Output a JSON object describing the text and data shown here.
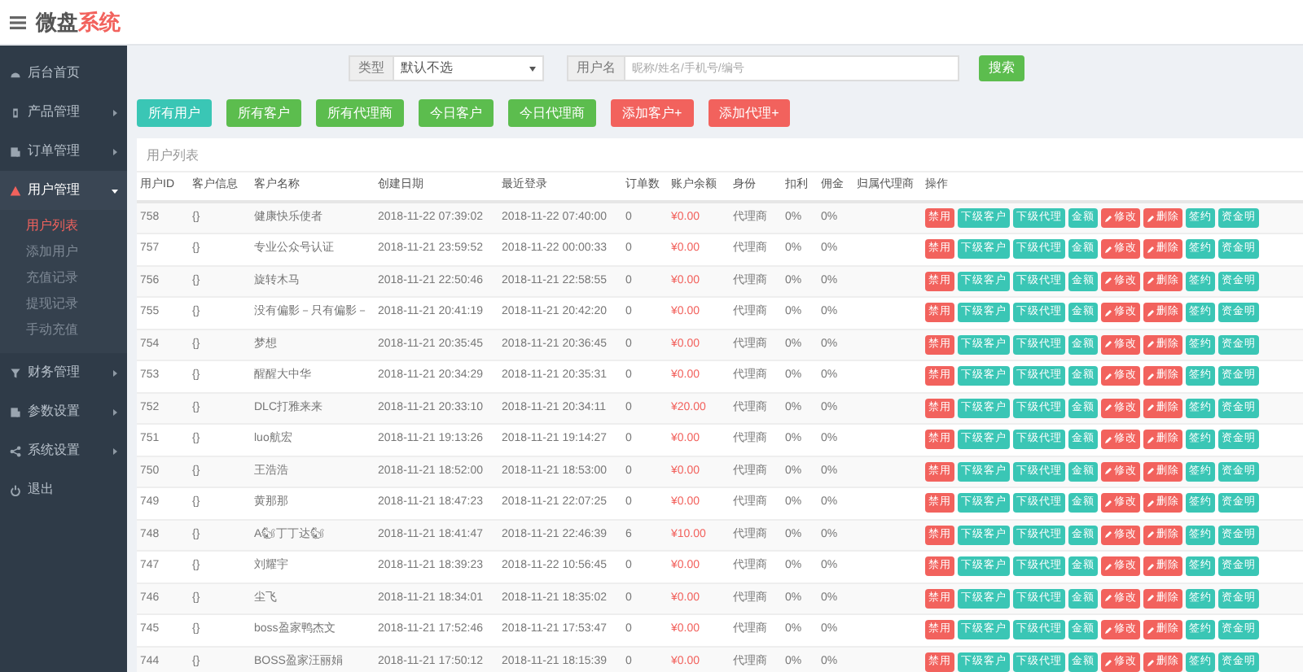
{
  "header": {
    "brand_main": "微盘",
    "brand_accent": "系统"
  },
  "sidebar": {
    "items": [
      {
        "label": "后台首页",
        "selected": false,
        "kind": "link"
      },
      {
        "label": "产品管理",
        "selected": false,
        "expanded": false,
        "kind": "group"
      },
      {
        "label": "订单管理",
        "selected": false,
        "expanded": false,
        "kind": "group"
      },
      {
        "label": "用户管理",
        "selected": true,
        "expanded": true,
        "kind": "group",
        "children": [
          {
            "label": "用户列表",
            "selected": true
          },
          {
            "label": "添加用户",
            "selected": false
          },
          {
            "label": "充值记录",
            "selected": false
          },
          {
            "label": "提现记录",
            "selected": false
          },
          {
            "label": "手动充值",
            "selected": false
          }
        ]
      },
      {
        "label": "财务管理",
        "selected": false,
        "expanded": false,
        "kind": "group"
      },
      {
        "label": "参数设置",
        "selected": false,
        "expanded": false,
        "kind": "group"
      },
      {
        "label": "系统设置",
        "selected": false,
        "expanded": false,
        "kind": "group"
      },
      {
        "label": "退出",
        "selected": false,
        "kind": "link"
      }
    ]
  },
  "filters": {
    "type_label": "类型",
    "type_value": "默认不选",
    "user_label": "用户名",
    "user_placeholder": "昵称/姓名/手机号/编号",
    "search_button": "搜索"
  },
  "quick_buttons": [
    {
      "label": "所有用户",
      "color": "#3ac6b5"
    },
    {
      "label": "所有客户",
      "color": "#5cbd4e"
    },
    {
      "label": "所有代理商",
      "color": "#5cbd4e"
    },
    {
      "label": "今日客户",
      "color": "#5cbd4e"
    },
    {
      "label": "今日代理商",
      "color": "#5cbd4e"
    },
    {
      "label": "添加客户+",
      "color": "#f2625d"
    },
    {
      "label": "添加代理+",
      "color": "#f2625d"
    }
  ],
  "panel": {
    "title": "用户列表"
  },
  "table": {
    "columns": [
      "用户ID",
      "客户信息",
      "客户名称",
      "创建日期",
      "最近登录",
      "订单数",
      "账户余额",
      "身份",
      "扣利",
      "佣金",
      "归属代理商",
      "操作"
    ],
    "rows": [
      {
        "id": "758",
        "info": "{}",
        "name": "健康快乐使者",
        "created": "2018-11-22 07:39:02",
        "last_login": "2018-11-22 07:40:00",
        "orders": "0",
        "balance": "¥0.00",
        "role": "代理商",
        "rebate": "0%",
        "commission": "0%",
        "actions": [
          {
            "kind": "disable",
            "label": "禁用",
            "color": "#f2625d"
          },
          {
            "kind": "sub-customers",
            "label": "下级客户",
            "color": "#3ac6b5"
          },
          {
            "kind": "sub-agents",
            "label": "下级代理",
            "color": "#3ac6b5"
          },
          {
            "kind": "amount",
            "label": "金额",
            "color": "#3ac6b5"
          },
          {
            "kind": "edit",
            "label": "修改",
            "color": "#f2625d"
          },
          {
            "kind": "delete",
            "label": "删除",
            "color": "#f2625d"
          },
          {
            "kind": "sign",
            "label": "签约",
            "color": "#3ac6b5"
          },
          {
            "kind": "funds",
            "label": "资金明",
            "color": "#3ac6b5"
          }
        ]
      },
      {
        "id": "757",
        "info": "{}",
        "name": "专业公众号认证",
        "created": "2018-11-21 23:59:52",
        "last_login": "2018-11-22 00:00:33",
        "orders": "0",
        "balance": "¥0.00",
        "role": "代理商",
        "rebate": "0%",
        "commission": "0%",
        "actions": [
          {
            "kind": "disable",
            "label": "禁用",
            "color": "#f2625d"
          },
          {
            "kind": "sub-customers",
            "label": "下级客户",
            "color": "#3ac6b5"
          },
          {
            "kind": "sub-agents",
            "label": "下级代理",
            "color": "#3ac6b5"
          },
          {
            "kind": "amount",
            "label": "金额",
            "color": "#3ac6b5"
          },
          {
            "kind": "edit",
            "label": "修改",
            "color": "#f2625d"
          },
          {
            "kind": "delete",
            "label": "删除",
            "color": "#f2625d"
          },
          {
            "kind": "sign",
            "label": "签约",
            "color": "#3ac6b5"
          },
          {
            "kind": "funds",
            "label": "资金明",
            "color": "#3ac6b5"
          }
        ]
      },
      {
        "id": "756",
        "info": "{}",
        "name": "旋转木马",
        "created": "2018-11-21 22:50:46",
        "last_login": "2018-11-21 22:58:55",
        "orders": "0",
        "balance": "¥0.00",
        "role": "代理商",
        "rebate": "0%",
        "commission": "0%",
        "actions": [
          {
            "kind": "disable",
            "label": "禁用",
            "color": "#f2625d"
          },
          {
            "kind": "sub-customers",
            "label": "下级客户",
            "color": "#3ac6b5"
          },
          {
            "kind": "sub-agents",
            "label": "下级代理",
            "color": "#3ac6b5"
          },
          {
            "kind": "amount",
            "label": "金额",
            "color": "#3ac6b5"
          },
          {
            "kind": "edit",
            "label": "修改",
            "color": "#f2625d"
          },
          {
            "kind": "delete",
            "label": "删除",
            "color": "#f2625d"
          },
          {
            "kind": "sign",
            "label": "签约",
            "color": "#3ac6b5"
          },
          {
            "kind": "funds",
            "label": "资金明",
            "color": "#3ac6b5"
          }
        ]
      },
      {
        "id": "755",
        "info": "{}",
        "name": "没有偏影－只有偏影－",
        "created": "2018-11-21 20:41:19",
        "last_login": "2018-11-21 20:42:20",
        "orders": "0",
        "balance": "¥0.00",
        "role": "代理商",
        "rebate": "0%",
        "commission": "0%",
        "actions": [
          {
            "kind": "disable",
            "label": "禁用",
            "color": "#f2625d"
          },
          {
            "kind": "sub-customers",
            "label": "下级客户",
            "color": "#3ac6b5"
          },
          {
            "kind": "sub-agents",
            "label": "下级代理",
            "color": "#3ac6b5"
          },
          {
            "kind": "amount",
            "label": "金额",
            "color": "#3ac6b5"
          },
          {
            "kind": "edit",
            "label": "修改",
            "color": "#f2625d"
          },
          {
            "kind": "delete",
            "label": "删除",
            "color": "#f2625d"
          },
          {
            "kind": "sign",
            "label": "签约",
            "color": "#3ac6b5"
          },
          {
            "kind": "funds",
            "label": "资金明",
            "color": "#3ac6b5"
          }
        ]
      },
      {
        "id": "754",
        "info": "{}",
        "name": "梦想",
        "created": "2018-11-21 20:35:45",
        "last_login": "2018-11-21 20:36:45",
        "orders": "0",
        "balance": "¥0.00",
        "role": "代理商",
        "rebate": "0%",
        "commission": "0%",
        "actions": [
          {
            "kind": "disable",
            "label": "禁用",
            "color": "#f2625d"
          },
          {
            "kind": "sub-customers",
            "label": "下级客户",
            "color": "#3ac6b5"
          },
          {
            "kind": "sub-agents",
            "label": "下级代理",
            "color": "#3ac6b5"
          },
          {
            "kind": "amount",
            "label": "金额",
            "color": "#3ac6b5"
          },
          {
            "kind": "edit",
            "label": "修改",
            "color": "#f2625d"
          },
          {
            "kind": "delete",
            "label": "删除",
            "color": "#f2625d"
          },
          {
            "kind": "sign",
            "label": "签约",
            "color": "#3ac6b5"
          },
          {
            "kind": "funds",
            "label": "资金明",
            "color": "#3ac6b5"
          }
        ]
      },
      {
        "id": "753",
        "info": "{}",
        "name": "醒醒大中华",
        "created": "2018-11-21 20:34:29",
        "last_login": "2018-11-21 20:35:31",
        "orders": "0",
        "balance": "¥0.00",
        "role": "代理商",
        "rebate": "0%",
        "commission": "0%",
        "actions": [
          {
            "kind": "disable",
            "label": "禁用",
            "color": "#f2625d"
          },
          {
            "kind": "sub-customers",
            "label": "下级客户",
            "color": "#3ac6b5"
          },
          {
            "kind": "sub-agents",
            "label": "下级代理",
            "color": "#3ac6b5"
          },
          {
            "kind": "amount",
            "label": "金额",
            "color": "#3ac6b5"
          },
          {
            "kind": "edit",
            "label": "修改",
            "color": "#f2625d"
          },
          {
            "kind": "delete",
            "label": "删除",
            "color": "#f2625d"
          },
          {
            "kind": "sign",
            "label": "签约",
            "color": "#3ac6b5"
          },
          {
            "kind": "funds",
            "label": "资金明",
            "color": "#3ac6b5"
          }
        ]
      },
      {
        "id": "752",
        "info": "{}",
        "name": "DLC打雅来来",
        "created": "2018-11-21 20:33:10",
        "last_login": "2018-11-21 20:34:11",
        "orders": "0",
        "balance": "¥20.00",
        "role": "代理商",
        "rebate": "0%",
        "commission": "0%",
        "actions": [
          {
            "kind": "disable",
            "label": "禁用",
            "color": "#f2625d"
          },
          {
            "kind": "sub-customers",
            "label": "下级客户",
            "color": "#3ac6b5"
          },
          {
            "kind": "sub-agents",
            "label": "下级代理",
            "color": "#3ac6b5"
          },
          {
            "kind": "amount",
            "label": "金额",
            "color": "#3ac6b5"
          },
          {
            "kind": "edit",
            "label": "修改",
            "color": "#f2625d"
          },
          {
            "kind": "delete",
            "label": "删除",
            "color": "#f2625d"
          },
          {
            "kind": "sign",
            "label": "签约",
            "color": "#3ac6b5"
          },
          {
            "kind": "funds",
            "label": "资金明",
            "color": "#3ac6b5"
          }
        ]
      },
      {
        "id": "751",
        "info": "{}",
        "name": "luo航宏",
        "created": "2018-11-21 19:13:26",
        "last_login": "2018-11-21 19:14:27",
        "orders": "0",
        "balance": "¥0.00",
        "role": "代理商",
        "rebate": "0%",
        "commission": "0%",
        "actions": [
          {
            "kind": "disable",
            "label": "禁用",
            "color": "#f2625d"
          },
          {
            "kind": "sub-customers",
            "label": "下级客户",
            "color": "#3ac6b5"
          },
          {
            "kind": "sub-agents",
            "label": "下级代理",
            "color": "#3ac6b5"
          },
          {
            "kind": "amount",
            "label": "金额",
            "color": "#3ac6b5"
          },
          {
            "kind": "edit",
            "label": "修改",
            "color": "#f2625d"
          },
          {
            "kind": "delete",
            "label": "删除",
            "color": "#f2625d"
          },
          {
            "kind": "sign",
            "label": "签约",
            "color": "#3ac6b5"
          },
          {
            "kind": "funds",
            "label": "资金明",
            "color": "#3ac6b5"
          }
        ]
      },
      {
        "id": "750",
        "info": "{}",
        "name": "王浩浩",
        "created": "2018-11-21 18:52:00",
        "last_login": "2018-11-21 18:53:00",
        "orders": "0",
        "balance": "¥0.00",
        "role": "代理商",
        "rebate": "0%",
        "commission": "0%",
        "actions": [
          {
            "kind": "disable",
            "label": "禁用",
            "color": "#f2625d"
          },
          {
            "kind": "sub-customers",
            "label": "下级客户",
            "color": "#3ac6b5"
          },
          {
            "kind": "sub-agents",
            "label": "下级代理",
            "color": "#3ac6b5"
          },
          {
            "kind": "amount",
            "label": "金额",
            "color": "#3ac6b5"
          },
          {
            "kind": "edit",
            "label": "修改",
            "color": "#f2625d"
          },
          {
            "kind": "delete",
            "label": "删除",
            "color": "#f2625d"
          },
          {
            "kind": "sign",
            "label": "签约",
            "color": "#3ac6b5"
          },
          {
            "kind": "funds",
            "label": "资金明",
            "color": "#3ac6b5"
          }
        ]
      },
      {
        "id": "749",
        "info": "{}",
        "name": "黄那那",
        "created": "2018-11-21 18:47:23",
        "last_login": "2018-11-21 22:07:25",
        "orders": "0",
        "balance": "¥0.00",
        "role": "代理商",
        "rebate": "0%",
        "commission": "0%",
        "actions": [
          {
            "kind": "disable",
            "label": "禁用",
            "color": "#f2625d"
          },
          {
            "kind": "sub-customers",
            "label": "下级客户",
            "color": "#3ac6b5"
          },
          {
            "kind": "sub-agents",
            "label": "下级代理",
            "color": "#3ac6b5"
          },
          {
            "kind": "amount",
            "label": "金额",
            "color": "#3ac6b5"
          },
          {
            "kind": "edit",
            "label": "修改",
            "color": "#f2625d"
          },
          {
            "kind": "delete",
            "label": "删除",
            "color": "#f2625d"
          },
          {
            "kind": "sign",
            "label": "签约",
            "color": "#3ac6b5"
          },
          {
            "kind": "funds",
            "label": "资金明",
            "color": "#3ac6b5"
          }
        ]
      },
      {
        "id": "748",
        "info": "{}",
        "name": "A🐿丁丁达🐿",
        "created": "2018-11-21 18:41:47",
        "last_login": "2018-11-21 22:46:39",
        "orders": "6",
        "balance": "¥10.00",
        "role": "代理商",
        "rebate": "0%",
        "commission": "0%",
        "actions": [
          {
            "kind": "disable",
            "label": "禁用",
            "color": "#f2625d"
          },
          {
            "kind": "sub-customers",
            "label": "下级客户",
            "color": "#3ac6b5"
          },
          {
            "kind": "sub-agents",
            "label": "下级代理",
            "color": "#3ac6b5"
          },
          {
            "kind": "amount",
            "label": "金额",
            "color": "#3ac6b5"
          },
          {
            "kind": "edit",
            "label": "修改",
            "color": "#f2625d"
          },
          {
            "kind": "delete",
            "label": "删除",
            "color": "#f2625d"
          },
          {
            "kind": "sign",
            "label": "签约",
            "color": "#3ac6b5"
          },
          {
            "kind": "funds",
            "label": "资金明",
            "color": "#3ac6b5"
          }
        ]
      },
      {
        "id": "747",
        "info": "{}",
        "name": "刘耀宇",
        "created": "2018-11-21 18:39:23",
        "last_login": "2018-11-22 10:56:45",
        "orders": "0",
        "balance": "¥0.00",
        "role": "代理商",
        "rebate": "0%",
        "commission": "0%",
        "actions": [
          {
            "kind": "disable",
            "label": "禁用",
            "color": "#f2625d"
          },
          {
            "kind": "sub-customers",
            "label": "下级客户",
            "color": "#3ac6b5"
          },
          {
            "kind": "sub-agents",
            "label": "下级代理",
            "color": "#3ac6b5"
          },
          {
            "kind": "amount",
            "label": "金额",
            "color": "#3ac6b5"
          },
          {
            "kind": "edit",
            "label": "修改",
            "color": "#f2625d"
          },
          {
            "kind": "delete",
            "label": "删除",
            "color": "#f2625d"
          },
          {
            "kind": "sign",
            "label": "签约",
            "color": "#3ac6b5"
          },
          {
            "kind": "funds",
            "label": "资金明",
            "color": "#3ac6b5"
          }
        ]
      },
      {
        "id": "746",
        "info": "{}",
        "name": "尘飞",
        "created": "2018-11-21 18:34:01",
        "last_login": "2018-11-21 18:35:02",
        "orders": "0",
        "balance": "¥0.00",
        "role": "代理商",
        "rebate": "0%",
        "commission": "0%",
        "actions": [
          {
            "kind": "disable",
            "label": "禁用",
            "color": "#f2625d"
          },
          {
            "kind": "sub-customers",
            "label": "下级客户",
            "color": "#3ac6b5"
          },
          {
            "kind": "sub-agents",
            "label": "下级代理",
            "color": "#3ac6b5"
          },
          {
            "kind": "amount",
            "label": "金额",
            "color": "#3ac6b5"
          },
          {
            "kind": "edit",
            "label": "修改",
            "color": "#f2625d"
          },
          {
            "kind": "delete",
            "label": "删除",
            "color": "#f2625d"
          },
          {
            "kind": "sign",
            "label": "签约",
            "color": "#3ac6b5"
          },
          {
            "kind": "funds",
            "label": "资金明",
            "color": "#3ac6b5"
          }
        ]
      },
      {
        "id": "745",
        "info": "{}",
        "name": "boss盈家鸭杰文",
        "created": "2018-11-21 17:52:46",
        "last_login": "2018-11-21 17:53:47",
        "orders": "0",
        "balance": "¥0.00",
        "role": "代理商",
        "rebate": "0%",
        "commission": "0%",
        "actions": [
          {
            "kind": "disable",
            "label": "禁用",
            "color": "#f2625d"
          },
          {
            "kind": "sub-customers",
            "label": "下级客户",
            "color": "#3ac6b5"
          },
          {
            "kind": "sub-agents",
            "label": "下级代理",
            "color": "#3ac6b5"
          },
          {
            "kind": "amount",
            "label": "金额",
            "color": "#3ac6b5"
          },
          {
            "kind": "edit",
            "label": "修改",
            "color": "#f2625d"
          },
          {
            "kind": "delete",
            "label": "删除",
            "color": "#f2625d"
          },
          {
            "kind": "sign",
            "label": "签约",
            "color": "#3ac6b5"
          },
          {
            "kind": "funds",
            "label": "资金明",
            "color": "#3ac6b5"
          }
        ]
      },
      {
        "id": "744",
        "info": "{}",
        "name": "BOSS盈家汪丽娟",
        "created": "2018-11-21 17:50:12",
        "last_login": "2018-11-21 18:15:39",
        "orders": "0",
        "balance": "¥0.00",
        "role": "代理商",
        "rebate": "0%",
        "commission": "0%",
        "actions": [
          {
            "kind": "disable",
            "label": "禁用",
            "color": "#f2625d"
          },
          {
            "kind": "sub-customers",
            "label": "下级客户",
            "color": "#3ac6b5"
          },
          {
            "kind": "sub-agents",
            "label": "下级代理",
            "color": "#3ac6b5"
          },
          {
            "kind": "amount",
            "label": "金额",
            "color": "#3ac6b5"
          },
          {
            "kind": "edit",
            "label": "修改",
            "color": "#f2625d"
          },
          {
            "kind": "delete",
            "label": "删除",
            "color": "#f2625d"
          },
          {
            "kind": "sign",
            "label": "签约",
            "color": "#3ac6b5"
          },
          {
            "kind": "funds",
            "label": "资金明",
            "color": "#3ac6b5"
          }
        ]
      }
    ]
  }
}
